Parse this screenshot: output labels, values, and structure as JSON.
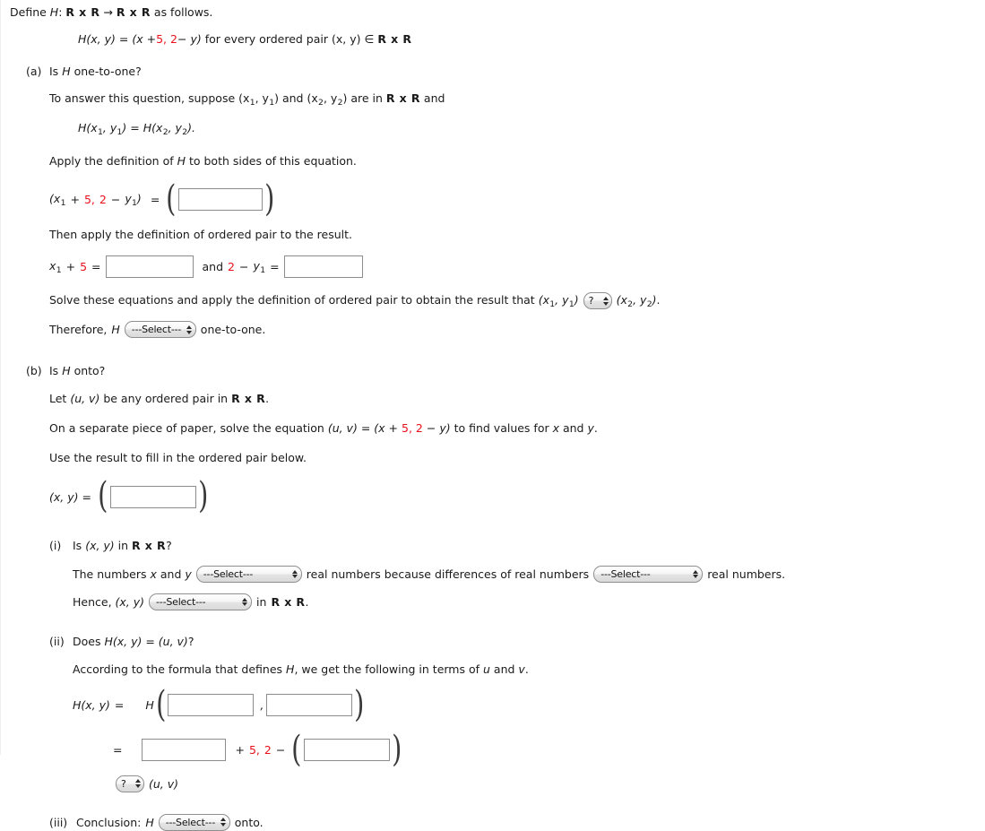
{
  "problem": {
    "define_line": {
      "prefix": "Define",
      "fn": "H",
      "colon": ":",
      "domain": "R x R",
      "arrow": "→",
      "codomain": "R x R",
      "suffix": "as follows."
    },
    "formula": {
      "lhs": "H(x, y)",
      "eq": "=",
      "open": "(x +",
      "const1": "5",
      "mid": ",",
      "const2": "2",
      "minus": "−",
      "close": "y)",
      "tail": "for every ordered pair (x, y)",
      "in_symbol": "∈",
      "set": "R x R"
    }
  },
  "part_a": {
    "label": "(a)",
    "question": "Is H one-to-one?",
    "suppose_line": {
      "text_1": "To answer this question, suppose (x",
      "sub_1": "1",
      "text_2": ", y",
      "sub_2": "1",
      "text_3": ") and (x",
      "sub_3": "2",
      "text_4": ", y",
      "sub_4": "2",
      "text_5": ") are in",
      "set": "R x R",
      "text_6": "and"
    },
    "equality": "H(x1, y1) = H(x2, y2).",
    "apply_def": "Apply the definition of H to both sides of this equation.",
    "eq_row": {
      "lhs_open": "(x",
      "lhs_sub1": "1",
      "lhs_plus": "+",
      "lhs_const1": "5",
      "lhs_comma": ",",
      "lhs_const2": "2",
      "lhs_minus": "−",
      "lhs_y": "y",
      "lhs_sub2": "1",
      "lhs_close": ")",
      "eq": "=",
      "answer_value": "",
      "answer_placeholder": ""
    },
    "then_apply": "Then apply the definition of ordered pair to the result.",
    "two_eq_row": {
      "left_lhs_x": "x",
      "left_sub": "1",
      "left_plus": "+",
      "left_const": "5",
      "left_eq": "=",
      "left_value": "",
      "conj": "and",
      "right_const": "2",
      "right_minus": "−",
      "right_y": "y",
      "right_sub": "1",
      "right_eq": "=",
      "right_value": ""
    },
    "solve_line": {
      "text_1": "Solve these equations and apply the definition of ordered pair to obtain the result that (x",
      "sub_1": "1",
      "text_2": ", y",
      "sub_2": "1",
      "text_3": ")",
      "select_value": "?",
      "text_4": "(x",
      "sub_3": "2",
      "text_5": ", y",
      "sub_4": "2",
      "text_6": ")."
    },
    "therefore_line": {
      "text_1": "Therefore,",
      "fn": "H",
      "select_value": "---Select---",
      "text_2": "one-to-one."
    }
  },
  "part_b": {
    "label": "(b)",
    "question": "Is H onto?",
    "let_line": {
      "text_1": "Let (u, v) be any ordered pair in",
      "set": "R x R",
      "text_2": "."
    },
    "solve_paper_line": {
      "text_1": "On a separate piece of paper, solve the equation (u, v) = (x +",
      "const1": "5",
      "comma": ",",
      "const2": "2",
      "minus": "−",
      "text_2": "y) to find values for x and y."
    },
    "use_result": "Use the result to fill in the ordered pair below.",
    "ordered_pair_row": {
      "lhs": "(x, y) =",
      "answer_value": ""
    },
    "item_i": {
      "label": "(i)",
      "question_text_1": "Is (x, y) in",
      "question_set": "R x R",
      "question_text_2": "?",
      "numbers_line": {
        "text_1": "The numbers x and y",
        "select_1": "---Select---",
        "text_2": "real numbers because differences of real numbers",
        "select_2": "---Select---",
        "text_3": "real numbers."
      },
      "hence_line": {
        "text_1": "Hence, (x, y)",
        "select": "---Select---",
        "text_2": "in",
        "set": "R x R",
        "text_3": "."
      }
    },
    "item_ii": {
      "label": "(ii)",
      "question": "Does H(x, y) = (u, v)?",
      "according_to": "According to the formula that defines H, we get the following in terms of u and v.",
      "row_1": {
        "lhs": "H(x, y)",
        "eq": "=",
        "fn": "H",
        "answer_1": "",
        "comma": ",",
        "answer_2": ""
      },
      "row_2": {
        "eq": "=",
        "answer_1": "",
        "plus": "+",
        "const1": "5",
        "comma": ",",
        "const2": "2",
        "minus": "−",
        "answer_2": ""
      },
      "row_3": {
        "select_value": "?",
        "text": "(u, v)"
      }
    },
    "item_iii": {
      "label": "(iii)",
      "text_1": "Conclusion:",
      "fn": "H",
      "select_value": "---Select---",
      "text_2": "onto."
    }
  },
  "colors": {
    "accent_red": "#e8101b",
    "text": "#1a1a1a",
    "box_border": "#8c8c8c"
  }
}
